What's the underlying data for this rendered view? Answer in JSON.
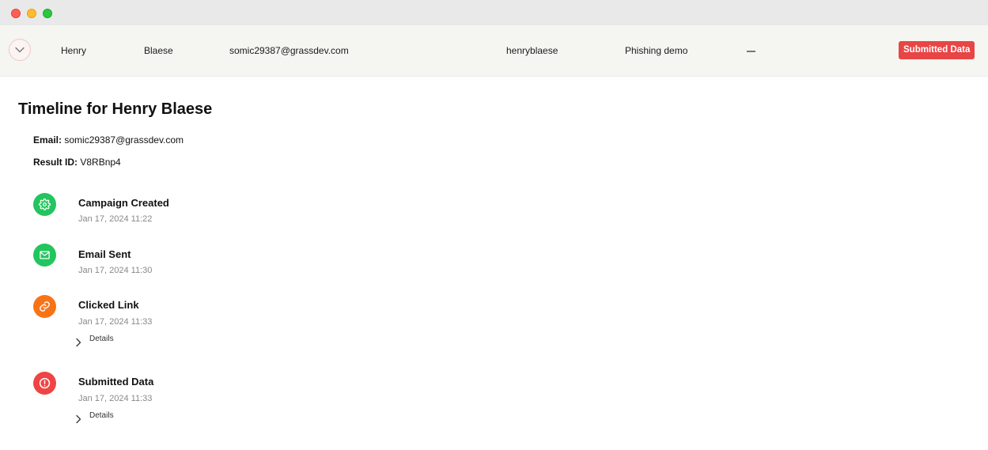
{
  "window": {
    "controls": [
      "close",
      "minimize",
      "maximize"
    ]
  },
  "result_row": {
    "toggle_icon": "chevron-down-icon",
    "first_name": "Henry",
    "last_name": "Blaese",
    "email": "somic29387@grassdev.com",
    "username": "henryblaese",
    "position": "Phishing demo",
    "reported": "—",
    "status": "Submitted Data",
    "status_color": "#e84545"
  },
  "timeline": {
    "title": "Timeline for Henry Blaese",
    "email_label": "Email:",
    "email_value": "somic29387@grassdev.com",
    "result_id_label": "Result ID:",
    "result_id_value": "V8RBnp4",
    "events": [
      {
        "title": "Campaign Created",
        "time": "Jan 17, 2024 11:22",
        "icon": "gear-icon",
        "color": "#22c55e"
      },
      {
        "title": "Email Sent",
        "time": "Jan 17, 2024 11:30",
        "icon": "envelope-icon",
        "color": "#22c55e"
      },
      {
        "title": "Clicked Link",
        "time": "Jan 17, 2024 11:33",
        "icon": "link-icon",
        "color": "#f97316",
        "details_label": "Details"
      },
      {
        "title": "Submitted Data",
        "time": "Jan 17, 2024 11:33",
        "icon": "alert-circle-icon",
        "color": "#ef4444",
        "details_label": "Details"
      }
    ]
  }
}
